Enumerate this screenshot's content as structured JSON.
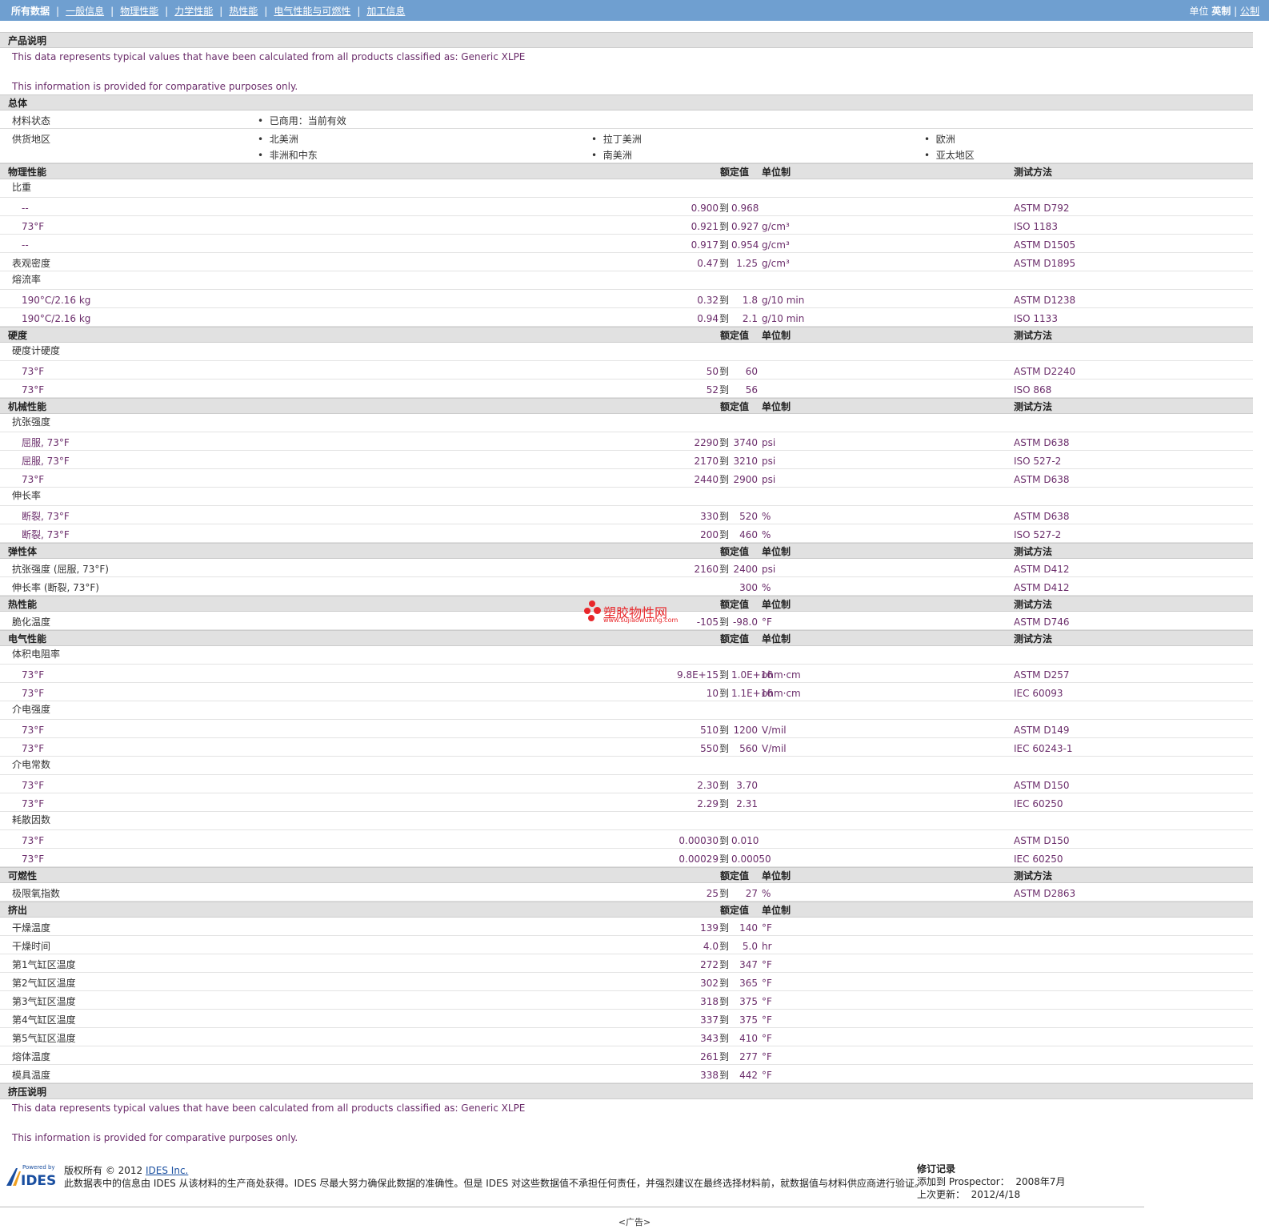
{
  "nav": {
    "items": [
      "所有数据",
      "一般信息",
      "物理性能",
      "力学性能",
      "热性能",
      "电气性能与可燃性",
      "加工信息"
    ],
    "units_label": "单位",
    "units_current": "英制",
    "units_alt": "公制"
  },
  "product_desc": {
    "title": "产品说明",
    "line1": "This data represents typical values that have been calculated from all products classified as: Generic XLPE",
    "line2": "This information is provided for comparative purposes only."
  },
  "general": {
    "title": "总体",
    "status_label": "材料状态",
    "status_value": "已商用：当前有效",
    "region_label": "供货地区",
    "regions": [
      "北美洲",
      "拉丁美洲",
      "欧洲",
      "非洲和中东",
      "南美洲",
      "亚太地区"
    ]
  },
  "headers": {
    "value": "额定值",
    "unit": "单位制",
    "method": "测试方法"
  },
  "to_word": "到",
  "sections": [
    {
      "title": "物理性能",
      "method_header": true,
      "rows": [
        {
          "sub": "比重"
        },
        {
          "name": "--",
          "ind": true,
          "min": "0.900",
          "max": "0.968",
          "unit": "",
          "method": "ASTM D792"
        },
        {
          "name": "73°F",
          "ind": true,
          "min": "0.921",
          "max": "0.927",
          "unit": "g/cm³",
          "method": "ISO 1183"
        },
        {
          "name": "--",
          "ind": true,
          "min": "0.917",
          "max": "0.954",
          "unit": "g/cm³",
          "method": "ASTM D1505"
        },
        {
          "name": "表观密度",
          "min": "0.47",
          "max": "1.25",
          "unit": "g/cm³",
          "method": "ASTM D1895"
        },
        {
          "sub": "熔流率"
        },
        {
          "name": "190°C/2.16 kg",
          "ind": true,
          "min": "0.32",
          "max": "1.8",
          "unit": "g/10 min",
          "method": "ASTM D1238"
        },
        {
          "name": "190°C/2.16 kg",
          "ind": true,
          "min": "0.94",
          "max": "2.1",
          "unit": "g/10 min",
          "method": "ISO 1133"
        }
      ]
    },
    {
      "title": "硬度",
      "method_header": true,
      "rows": [
        {
          "sub": "硬度计硬度"
        },
        {
          "name": "73°F",
          "ind": true,
          "min": "50",
          "max": "60",
          "unit": "",
          "method": "ASTM D2240"
        },
        {
          "name": "73°F",
          "ind": true,
          "min": "52",
          "max": "56",
          "unit": "",
          "method": "ISO 868"
        }
      ]
    },
    {
      "title": "机械性能",
      "method_header": true,
      "rows": [
        {
          "sub": "抗张强度"
        },
        {
          "name": "屈服, 73°F",
          "ind": true,
          "min": "2290",
          "max": "3740",
          "unit": "psi",
          "method": "ASTM D638"
        },
        {
          "name": "屈服, 73°F",
          "ind": true,
          "min": "2170",
          "max": "3210",
          "unit": "psi",
          "method": "ISO 527-2"
        },
        {
          "name": "73°F",
          "ind": true,
          "min": "2440",
          "max": "2900",
          "unit": "psi",
          "method": "ASTM D638"
        },
        {
          "sub": "伸长率"
        },
        {
          "name": "断裂, 73°F",
          "ind": true,
          "min": "330",
          "max": "520",
          "unit": "%",
          "method": "ASTM D638"
        },
        {
          "name": "断裂, 73°F",
          "ind": true,
          "min": "200",
          "max": "460",
          "unit": "%",
          "method": "ISO 527-2"
        }
      ]
    },
    {
      "title": "弹性体",
      "method_header": true,
      "rows": [
        {
          "name": "抗张强度 (屈服, 73°F)",
          "min": "2160",
          "max": "2400",
          "unit": "psi",
          "method": "ASTM D412"
        },
        {
          "name": "伸长率 (断裂, 73°F)",
          "single": "300",
          "unit": "%",
          "method": "ASTM D412"
        }
      ]
    },
    {
      "title": "热性能",
      "method_header": true,
      "rows": [
        {
          "name": "脆化温度",
          "min": "-105",
          "max": "-98.0",
          "unit": "°F",
          "method": "ASTM D746"
        }
      ]
    },
    {
      "title": "电气性能",
      "method_header": true,
      "rows": [
        {
          "sub": "体积电阻率"
        },
        {
          "name": "73°F",
          "ind": true,
          "min": "9.8E+15",
          "max": "1.0E+16",
          "unit": "ohm·cm",
          "method": "ASTM D257"
        },
        {
          "name": "73°F",
          "ind": true,
          "min": "10",
          "max": "1.1E+16",
          "unit": "ohm·cm",
          "method": "IEC 60093"
        },
        {
          "sub": "介电强度"
        },
        {
          "name": "73°F",
          "ind": true,
          "min": "510",
          "max": "1200",
          "unit": "V/mil",
          "method": "ASTM D149"
        },
        {
          "name": "73°F",
          "ind": true,
          "min": "550",
          "max": "560",
          "unit": "V/mil",
          "method": "IEC 60243-1"
        },
        {
          "sub": "介电常数"
        },
        {
          "name": "73°F",
          "ind": true,
          "min": "2.30",
          "max": "3.70",
          "unit": "",
          "method": "ASTM D150"
        },
        {
          "name": "73°F",
          "ind": true,
          "min": "2.29",
          "max": "2.31",
          "unit": "",
          "method": "IEC 60250"
        },
        {
          "sub": "耗散因数"
        },
        {
          "name": "73°F",
          "ind": true,
          "min": "0.00030",
          "max": "0.010",
          "unit": "",
          "method": "ASTM D150"
        },
        {
          "name": "73°F",
          "ind": true,
          "min": "0.00029",
          "max": "0.00050",
          "unit": "",
          "method": "IEC 60250"
        }
      ]
    },
    {
      "title": "可燃性",
      "method_header": true,
      "rows": [
        {
          "name": "极限氧指数",
          "min": "25",
          "max": "27",
          "unit": "%",
          "method": "ASTM D2863"
        }
      ]
    },
    {
      "title": "挤出",
      "method_header": false,
      "rows": [
        {
          "name": "干燥温度",
          "min": "139",
          "max": "140",
          "unit": "°F",
          "method": ""
        },
        {
          "name": "干燥时间",
          "min": "4.0",
          "max": "5.0",
          "unit": "hr",
          "method": ""
        },
        {
          "name": "第1气缸区温度",
          "min": "272",
          "max": "347",
          "unit": "°F",
          "method": ""
        },
        {
          "name": "第2气缸区温度",
          "min": "302",
          "max": "365",
          "unit": "°F",
          "method": ""
        },
        {
          "name": "第3气缸区温度",
          "min": "318",
          "max": "375",
          "unit": "°F",
          "method": ""
        },
        {
          "name": "第4气缸区温度",
          "min": "337",
          "max": "375",
          "unit": "°F",
          "method": ""
        },
        {
          "name": "第5气缸区温度",
          "min": "343",
          "max": "410",
          "unit": "°F",
          "method": ""
        },
        {
          "name": "熔体温度",
          "min": "261",
          "max": "277",
          "unit": "°F",
          "method": ""
        },
        {
          "name": "模具温度",
          "min": "338",
          "max": "442",
          "unit": "°F",
          "method": ""
        }
      ]
    }
  ],
  "extrusion_note": {
    "title": "挤压说明",
    "line1": "This data represents typical values that have been calculated from all products classified as: Generic XLPE",
    "line2": "This information is provided for comparative purposes only."
  },
  "footer": {
    "logo_small": "Powered by",
    "logo_big": "IDES",
    "copyright": "版权所有 © 2012",
    "company_link": "IDES Inc.",
    "disclaimer": "此数据表中的信息由 IDES 从该材料的生产商处获得。IDES 尽最大努力确保此数据的准确性。但是 IDES 对这些数据值不承担任何责任，并强烈建议在最终选择材料前，就数据值与材料供应商进行验证。",
    "rev_title": "修订记录",
    "added_label": "添加到 Prospector：",
    "added_value": "2008年7月",
    "updated_label": "上次更新：",
    "updated_value": "2012/4/18"
  },
  "ad": "<广告>",
  "watermark": {
    "cn": "塑胶物性网",
    "url": "www.sujiaowuxing.com",
    "color": "#e8272b"
  }
}
